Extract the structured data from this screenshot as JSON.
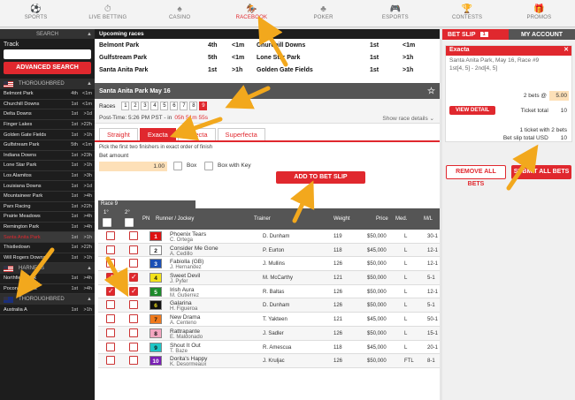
{
  "nav": [
    {
      "label": "SPORTS",
      "icon": "⚽"
    },
    {
      "label": "LIVE BETTING",
      "icon": "⏱"
    },
    {
      "label": "CASINO",
      "icon": "♠"
    },
    {
      "label": "RACEBOOK",
      "icon": "🏇"
    },
    {
      "label": "POKER",
      "icon": "♣"
    },
    {
      "label": "ESPORTS",
      "icon": "🎮"
    },
    {
      "label": "CONTESTS",
      "icon": "🏆"
    },
    {
      "label": "PROMOS",
      "icon": "🎁"
    }
  ],
  "sidebar": {
    "search_label": "SEARCH",
    "track_label": "Track",
    "adv_label": "ADVANCED SEARCH",
    "cat1": "THOROUGHBRED",
    "cat2": "HARNESS",
    "cat3": "THOROUGHBRED",
    "tracks1": [
      {
        "n": "Belmont Park",
        "r": "4th",
        "t": "<1m"
      },
      {
        "n": "Churchill Downs",
        "r": "1st",
        "t": "<1m"
      },
      {
        "n": "Delta Downs",
        "r": "1st",
        "t": ">1d"
      },
      {
        "n": "Finger Lakes",
        "r": "1st",
        "t": ">22h"
      },
      {
        "n": "Golden Gate Fields",
        "r": "1st",
        "t": ">1h"
      },
      {
        "n": "Gulfstream Park",
        "r": "5th",
        "t": "<1m"
      },
      {
        "n": "Indiana Downs",
        "r": "1st",
        "t": ">23h"
      },
      {
        "n": "Lone Star Park",
        "r": "1st",
        "t": ">1h"
      },
      {
        "n": "Los Alamitos",
        "r": "1st",
        "t": ">3h"
      },
      {
        "n": "Louisiana Downs",
        "r": "1st",
        "t": ">1d"
      },
      {
        "n": "Mountaineer Park",
        "r": "1st",
        "t": ">4h"
      },
      {
        "n": "Parx Racing",
        "r": "1st",
        "t": ">22h"
      },
      {
        "n": "Prairie Meadows",
        "r": "1st",
        "t": ">4h"
      },
      {
        "n": "Remington Park",
        "r": "1st",
        "t": ">4h"
      },
      {
        "n": "Santa Anita Park",
        "r": "1st",
        "t": ">1h"
      },
      {
        "n": "Thistledown",
        "r": "1st",
        "t": ">22h"
      },
      {
        "n": "Will Rogers Downs",
        "r": "1st",
        "t": ">1h"
      }
    ],
    "tracks2": [
      {
        "n": "Northfield Park",
        "r": "1st",
        "t": ">4h"
      },
      {
        "n": "Pocono Downs",
        "r": "1st",
        "t": ">4h"
      }
    ],
    "tracks3": [
      {
        "n": "Australia A",
        "r": "1st",
        "t": ">1h"
      }
    ]
  },
  "upcoming": {
    "title": "Upcoming races",
    "rows": [
      [
        "Belmont Park",
        "4th",
        "<1m",
        "Churchill Downs",
        "1st",
        "<1m"
      ],
      [
        "Gulfstream Park",
        "5th",
        "<1m",
        "Lone Star Park",
        "1st",
        ">1h"
      ],
      [
        "Santa Anita Park",
        "1st",
        ">1h",
        "Golden Gate Fields",
        "1st",
        ">1h"
      ]
    ]
  },
  "race": {
    "header": "Santa Anita Park May 16",
    "races_label": "Races",
    "race_nums": [
      "1",
      "2",
      "3",
      "4",
      "5",
      "6",
      "7",
      "8",
      "9"
    ],
    "post_time": "Post-Time: 5:26 PM PST - in",
    "countdown": "05h 51m 55s",
    "show_details": "Show race details"
  },
  "tabs": [
    "Straight",
    "Exacta",
    "Trifecta",
    "Superfecta"
  ],
  "bet": {
    "desc": "Pick the first two finishers in exact order of finish",
    "amount_label": "Bet amount",
    "amount": "1.00",
    "box": "Box",
    "box_key": "Box with Key",
    "add": "ADD TO BET SLIP"
  },
  "grid": {
    "race_label": "Race 9",
    "c1": "1°",
    "c2": "2°",
    "pn": "PN",
    "runner": "Runner / Jockey",
    "trainer": "Trainer",
    "weight": "Weight",
    "price": "Price",
    "med": "Med.",
    "ml": "M/L",
    "rows": [
      {
        "pn": "1",
        "horse": "Phoenix Tears",
        "jockey": "C. Ortega",
        "trainer": "D. Dunham",
        "w": "119",
        "p": "$50,000",
        "m": "L",
        "ml": "30-1",
        "c1": false,
        "c2": false,
        "bg": "#d11",
        "fg": "#fff"
      },
      {
        "pn": "2",
        "horse": "Consider Me Gone",
        "jockey": "A. Cedillo",
        "trainer": "P. Eurton",
        "w": "118",
        "p": "$45,000",
        "m": "L",
        "ml": "12-1",
        "c1": false,
        "c2": false,
        "bg": "#fff",
        "fg": "#111"
      },
      {
        "pn": "3",
        "horse": "Fabiolla (GB)",
        "jockey": "J. Hernandez",
        "trainer": "J. Mullins",
        "w": "126",
        "p": "$50,000",
        "m": "L",
        "ml": "12-1",
        "c1": false,
        "c2": false,
        "bg": "#1a4fb5",
        "fg": "#fff"
      },
      {
        "pn": "4",
        "horse": "Sweet Devil",
        "jockey": "J. Pyfer",
        "trainer": "M. McCarthy",
        "w": "121",
        "p": "$50,000",
        "m": "L",
        "ml": "5-1",
        "c1": true,
        "c2": true,
        "bg": "#f3e21b",
        "fg": "#111"
      },
      {
        "pn": "5",
        "horse": "Irish Aura",
        "jockey": "M. Gutierrez",
        "trainer": "R. Baltas",
        "w": "126",
        "p": "$50,000",
        "m": "L",
        "ml": "12-1",
        "c1": true,
        "c2": true,
        "bg": "#1c8a2a",
        "fg": "#fff"
      },
      {
        "pn": "6",
        "horse": "Galarina",
        "jockey": "H. Figueroa",
        "trainer": "D. Dunham",
        "w": "126",
        "p": "$50,000",
        "m": "L",
        "ml": "5-1",
        "c1": false,
        "c2": false,
        "bg": "#111",
        "fg": "#f3e21b"
      },
      {
        "pn": "7",
        "horse": "New Drama",
        "jockey": "A. Centeno",
        "trainer": "T. Yakteen",
        "w": "121",
        "p": "$45,000",
        "m": "L",
        "ml": "50-1",
        "c1": false,
        "c2": false,
        "bg": "#f07a1c",
        "fg": "#111"
      },
      {
        "pn": "8",
        "horse": "Rattrapante",
        "jockey": "E. Maldonado",
        "trainer": "J. Sadler",
        "w": "126",
        "p": "$50,000",
        "m": "L",
        "ml": "15-1",
        "c1": false,
        "c2": false,
        "bg": "#f4a6c0",
        "fg": "#111"
      },
      {
        "pn": "9",
        "horse": "Shout It Out",
        "jockey": "T. Baze",
        "trainer": "R. Amescua",
        "w": "118",
        "p": "$45,000",
        "m": "L",
        "ml": "20-1",
        "c1": false,
        "c2": false,
        "bg": "#1fc6c6",
        "fg": "#111"
      },
      {
        "pn": "10",
        "horse": "Dorita's Happy",
        "jockey": "K. Desormeaux",
        "trainer": "J. Kruljac",
        "w": "126",
        "p": "$50,000",
        "m": "FTL",
        "ml": "8-1",
        "c1": false,
        "c2": false,
        "bg": "#7a1fb5",
        "fg": "#fff"
      }
    ]
  },
  "betslip": {
    "tab": "BET SLIP",
    "count": "1",
    "account": "MY ACCOUNT",
    "type": "Exacta",
    "race": "Santa Anita Park, May 16, Race #9",
    "picks": "1st[4, 5] - 2nd[4, 5]",
    "bets_label": "2 bets @",
    "bets_val": "5.00",
    "view": "VIEW DETAIL",
    "tt_label": "Ticket total",
    "tt_val": "10",
    "summary1": "1 ticket with 2 bets",
    "summary2_label": "Bet slip total USD",
    "summary2_val": "10",
    "remove": "REMOVE ALL BETS",
    "submit": "SUBMIT ALL BETS"
  },
  "colors": {
    "accent": "#e0282e",
    "arrow": "#f2a81d"
  }
}
